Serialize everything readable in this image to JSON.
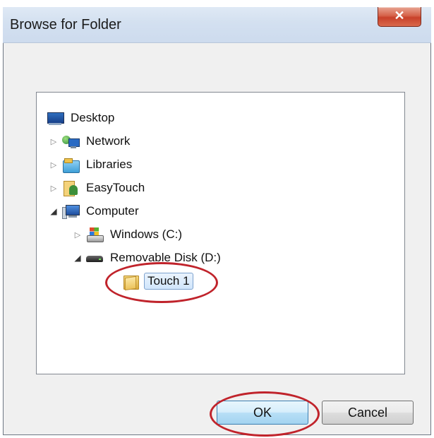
{
  "dialog": {
    "title": "Browse for Folder",
    "close_glyph": "✕"
  },
  "tree": [
    {
      "label": "Desktop",
      "icon": "desktop-icon",
      "expander": ""
    },
    {
      "label": "Network",
      "icon": "network-icon",
      "expander": "▷"
    },
    {
      "label": "Libraries",
      "icon": "libraries-icon",
      "expander": "▷"
    },
    {
      "label": "EasyTouch",
      "icon": "user-folder-icon",
      "expander": "▷"
    },
    {
      "label": "Computer",
      "icon": "computer-icon",
      "expander": "◢"
    },
    {
      "label": "Windows (C:)",
      "icon": "windows-drive-icon",
      "expander": "▷"
    },
    {
      "label": "Removable Disk (D:)",
      "icon": "removable-disk-icon",
      "expander": "◢"
    },
    {
      "label": "Touch 1",
      "icon": "folder-icon",
      "expander": "",
      "selected": true
    }
  ],
  "buttons": {
    "ok": "OK",
    "cancel": "Cancel"
  },
  "colors": {
    "highlight": "#c0232b",
    "selection": "#d0e5fb",
    "close_button": "#c8412a"
  }
}
